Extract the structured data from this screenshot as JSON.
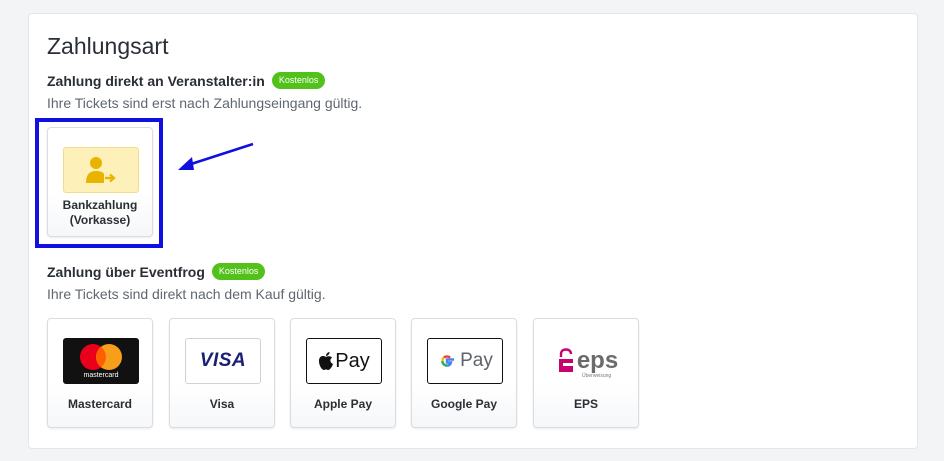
{
  "page": {
    "title": "Zahlungsart"
  },
  "direct": {
    "heading": "Zahlung direkt an Veranstalter:in",
    "badge": "Kostenlos",
    "subtext": "Ihre Tickets sind erst nach Zahlungseingang gültig.",
    "options": [
      {
        "label": "Bankzahlung\n(Vorkasse)",
        "icon": "person-transfer-icon"
      }
    ]
  },
  "eventfrog": {
    "heading": "Zahlung über Eventfrog",
    "badge": "Kostenlos",
    "subtext": "Ihre Tickets sind direkt nach dem Kauf gültig.",
    "options": [
      {
        "label": "Mastercard",
        "icon": "mastercard-logo",
        "logo_text": "mastercard"
      },
      {
        "label": "Visa",
        "icon": "visa-logo",
        "logo_text": "VISA"
      },
      {
        "label": "Apple Pay",
        "icon": "apple-pay-logo",
        "logo_text": "Pay"
      },
      {
        "label": "Google Pay",
        "icon": "google-pay-logo",
        "logo_text": "Pay"
      },
      {
        "label": "EPS",
        "icon": "eps-logo",
        "logo_text": "eps",
        "logo_subtext": "Überweisung"
      }
    ]
  },
  "colors": {
    "badge_green": "#52c21b",
    "highlight_blue": "#1010e0",
    "bank_tile_bg": "#fdf0b8",
    "bank_icon": "#e8b400",
    "mastercard_red": "#eb001b",
    "mastercard_orange": "#f79e1b",
    "visa_blue": "#1a1f71",
    "eps_pink": "#c8036f"
  }
}
